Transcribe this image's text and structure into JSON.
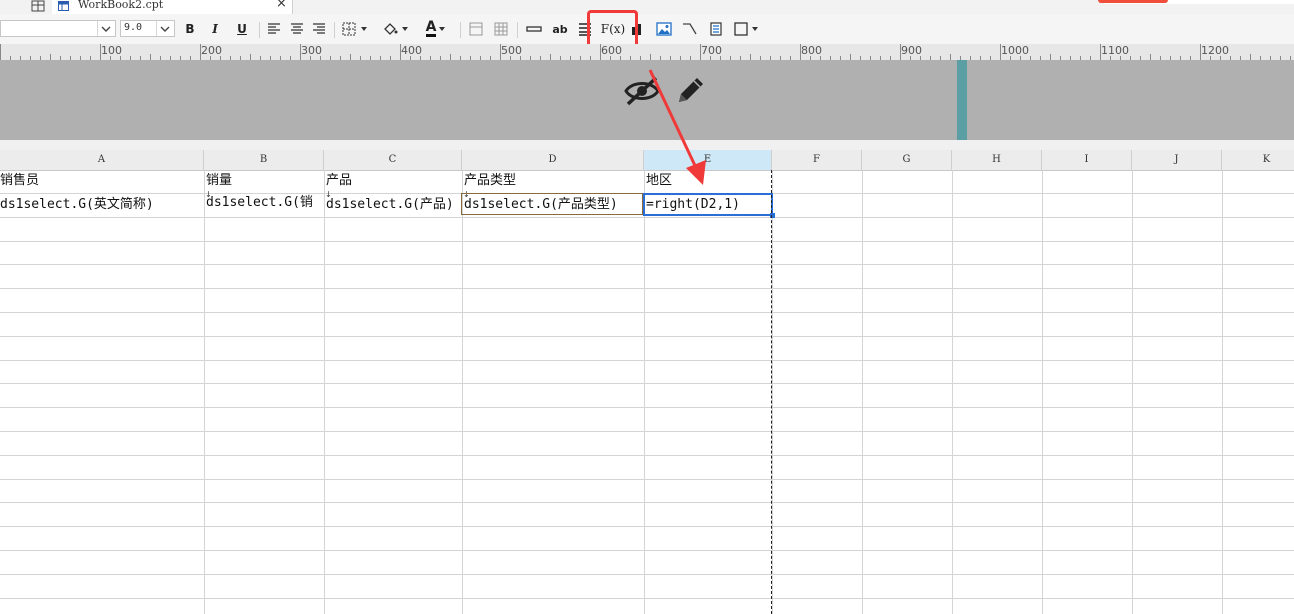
{
  "tabs": {
    "active_file": "WorkBook2.cpt",
    "close_glyph": "×"
  },
  "toolbar": {
    "font_size": "9.0",
    "bold_label": "B",
    "italic_label": "I",
    "underline_label": "U",
    "fx_label": "F(x)",
    "ab_label": "ab",
    "font_color_label": "A"
  },
  "ruler": {
    "labels": [
      "100",
      "200",
      "300",
      "400",
      "500",
      "600",
      "700",
      "800",
      "900",
      "1000",
      "1100",
      "1200"
    ]
  },
  "sheet": {
    "columns": [
      "A",
      "B",
      "C",
      "D",
      "E",
      "F",
      "G",
      "H",
      "I",
      "J",
      "K"
    ],
    "active_column": "E",
    "header_row": [
      "销售员",
      "销量",
      "产品",
      "产品类型",
      "地区"
    ],
    "data_row": [
      "ds1select.G(英文简称)",
      "ds1select.G(销",
      "ds1select.G(产品)",
      "ds1select.G(产品类型)",
      "=right(D2,1)"
    ]
  },
  "annotations": {
    "highlight_color": "#f03a3a"
  },
  "colors": {
    "band": "#b0b0b0",
    "band_bar": "#5b9ea4",
    "selection": "#2a6fd6"
  }
}
